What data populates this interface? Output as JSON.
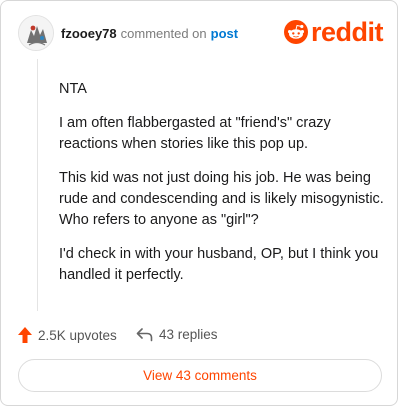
{
  "comment": {
    "username": "fzooey78",
    "action_text": "commented on",
    "post_link": "post",
    "body": [
      "NTA",
      "I am often flabbergasted at \"friend's\" crazy reactions when stories like this pop up.",
      "This kid was not just doing his job. He was being rude and condescending and is likely misogynistic. Who refers to anyone as \"girl\"?",
      "I'd check in with your husband, OP, but I think you handled it perfectly."
    ]
  },
  "brand": {
    "name": "reddit",
    "color": "#ff4500"
  },
  "actions": {
    "upvotes_label": "2.5K upvotes",
    "replies_label": "43 replies"
  },
  "footer": {
    "view_comments_label": "View 43 comments"
  },
  "icons": {
    "avatar": "avatar",
    "logo": "reddit-snoo-icon",
    "upvote": "upvote-arrow-icon",
    "reply": "reply-arrow-icon"
  }
}
